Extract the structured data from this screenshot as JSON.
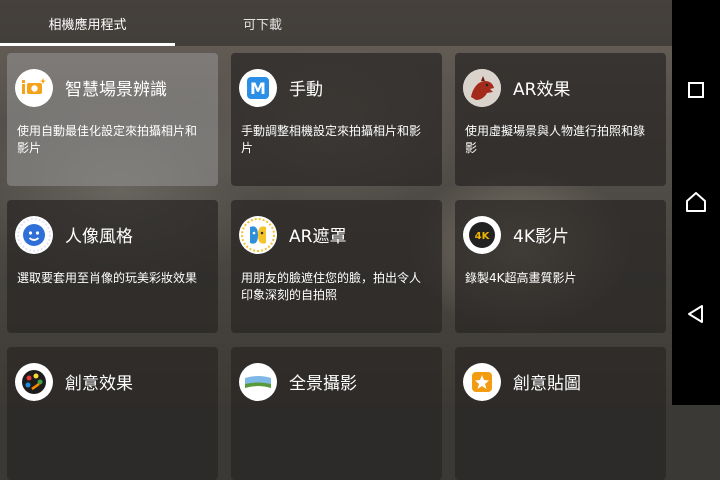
{
  "tabs": [
    {
      "label": "相機應用程式",
      "active": true
    },
    {
      "label": "可下載",
      "active": false
    }
  ],
  "cards": [
    {
      "title": "智慧場景辨識",
      "desc": "使用自動最佳化設定來拍攝相片和影片",
      "icon": "superior-auto-icon",
      "selected": true
    },
    {
      "title": "手動",
      "desc": "手動調整相機設定來拍攝相片和影片",
      "icon": "manual-m-icon"
    },
    {
      "title": "AR效果",
      "desc": "使用虛擬場景與人物進行拍照和錄影",
      "icon": "dinosaur-icon"
    },
    {
      "title": "人像風格",
      "desc": "選取要套用至肖像的玩美彩妝效果",
      "icon": "portrait-face-icon"
    },
    {
      "title": "AR遮罩",
      "desc": "用朋友的臉遮住您的臉，拍出令人印象深刻的自拍照",
      "icon": "ar-mask-icon"
    },
    {
      "title": "4K影片",
      "desc": "錄製4K超高畫質影片",
      "icon": "4k-icon"
    },
    {
      "title": "創意效果",
      "desc": "",
      "icon": "creative-effect-icon"
    },
    {
      "title": "全景攝影",
      "desc": "",
      "icon": "panorama-icon"
    },
    {
      "title": "創意貼圖",
      "desc": "",
      "icon": "sticker-star-icon"
    }
  ],
  "icons": {
    "4k_text": "4K",
    "manual_text": "M"
  },
  "navbar": {
    "buttons": [
      "recent-apps-icon",
      "home-icon",
      "back-icon"
    ]
  },
  "colors": {
    "manual_blue": "#2b8fe6",
    "dino_red": "#b03020",
    "face_blue": "#2f6fd8",
    "mask_yellow": "#f5c32a",
    "tile_orange": "#f39c12"
  }
}
